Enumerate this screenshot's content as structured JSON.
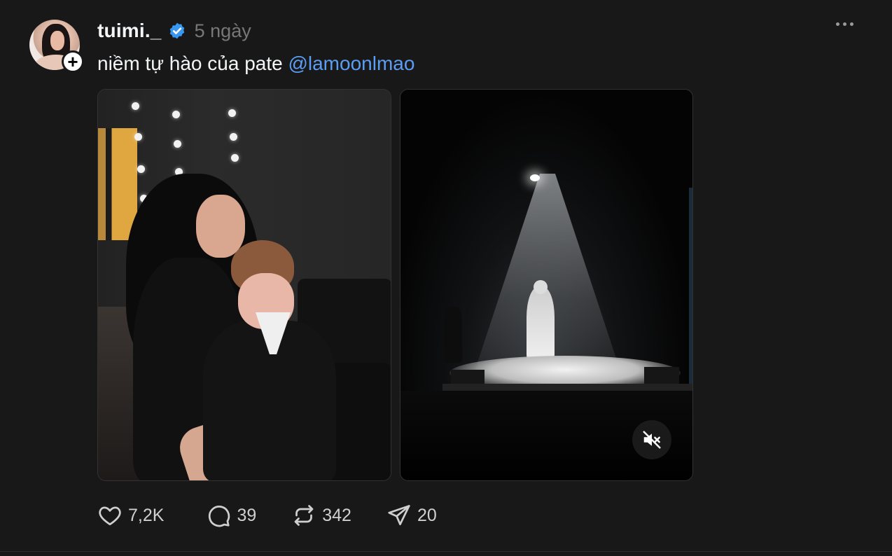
{
  "post": {
    "author": {
      "username": "tuimi._",
      "verified": true,
      "time_ago": "5 ngày",
      "follow_symbol": "+"
    },
    "caption": {
      "text": "niềm tự hào của pate ",
      "mention": "@lamoonlmao"
    },
    "media": [
      {
        "type": "photo",
        "icon": "photo"
      },
      {
        "type": "video",
        "muted": true,
        "icon": "mute-icon"
      }
    ],
    "actions": {
      "likes": "7,2K",
      "replies": "39",
      "reposts": "342",
      "shares": "20"
    }
  },
  "colors": {
    "background": "#181818",
    "text": "#f3f5f7",
    "muted": "#777777",
    "mention": "#5b9df3",
    "verified": "#3897f0"
  }
}
